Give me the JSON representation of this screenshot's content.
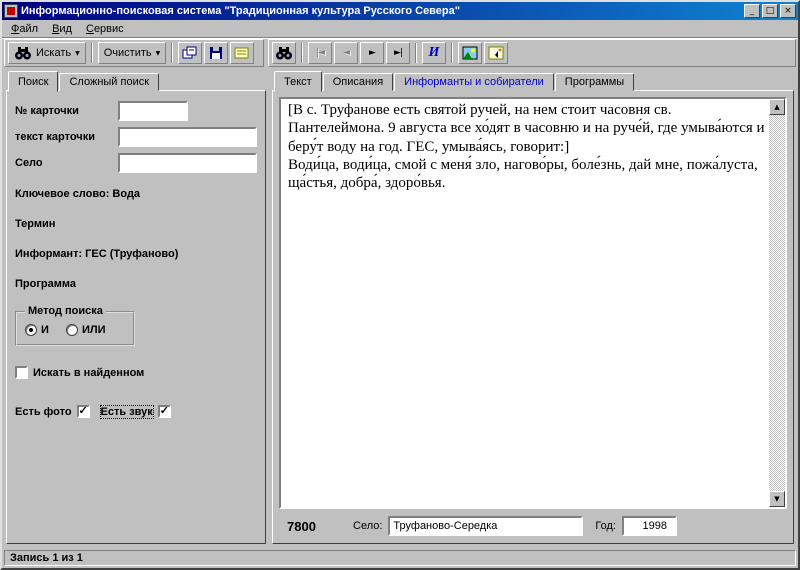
{
  "titlebar": {
    "title": "Информационно-поисковая система \"Традиционная культура Русского Севера\"",
    "minimize": "_",
    "maximize": "□",
    "close": "×"
  },
  "menu": {
    "items": [
      {
        "label": "Файл"
      },
      {
        "label": "Вид"
      },
      {
        "label": "Сервис"
      }
    ]
  },
  "toolbar": {
    "search_label": "Искать",
    "clear_label": "Очистить",
    "dropdown_glyph": "▼",
    "nav": {
      "first": "|◄",
      "prev": "◄",
      "next": "►",
      "last": "►|"
    },
    "info_glyph": "И"
  },
  "icons": {
    "scroll_up": "▲",
    "scroll_down": "▼",
    "check": "✓"
  },
  "search_panel": {
    "tabs": [
      {
        "label": "Поиск"
      },
      {
        "label": "Сложный поиск"
      }
    ],
    "fields": {
      "card_number": {
        "label": "№ карточки",
        "value": ""
      },
      "card_text": {
        "label": "текст карточки",
        "value": ""
      },
      "village": {
        "label": "Село",
        "value": ""
      }
    },
    "keyword": "Ключевое слово: Вода",
    "term": "Термин",
    "informant": "Информант: ГЕС (Труфаново)",
    "program": "Программа",
    "method": {
      "title": "Метод поиска",
      "and_label": "И",
      "or_label": "ИЛИ",
      "selected": "И"
    },
    "search_in_found": {
      "label": "Искать в найденном",
      "checked": false,
      "glyph": ""
    },
    "has_photo": {
      "label": "Есть фото",
      "checked": true,
      "glyph": "✓"
    },
    "has_sound": {
      "label": "Есть звук",
      "checked": true,
      "glyph": "✓"
    }
  },
  "card_panel": {
    "tabs": [
      {
        "label": "Текст",
        "color": "#000000"
      },
      {
        "label": "Описания",
        "color": "#000000"
      },
      {
        "label": "Информанты и собиратели",
        "color": "#0000cc"
      },
      {
        "label": "Программы",
        "color": "#000000"
      }
    ],
    "text": "[В с. Труфанове есть святой ручей, на нем стоит часовня св. Пантелеймона. 9 августа все хо́дят в часовню и на руче́й, где умыва́ются и беру́т воду на год. ГЕС, умыва́ясь, говорит:]\nВоди́ца, води́ца, смой с меня́ зло, нагово́ры, боле́знь, дай мне, пожа́луста, ща́стья, добра́, здоро́вья.",
    "record_number": "7800",
    "village_label": "Село:",
    "village_value": "Труфаново-Середка",
    "year_label": "Год:",
    "year_value": "1998"
  },
  "statusbar": {
    "text": "Запись 1 из 1"
  }
}
